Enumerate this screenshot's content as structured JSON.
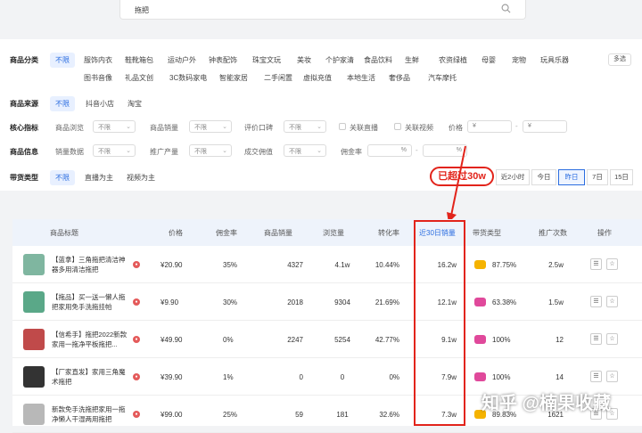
{
  "search": {
    "value": "拖把"
  },
  "filters": {
    "category": {
      "label": "商品分类",
      "options": [
        "不限",
        "服饰内衣",
        "鞋靴箱包",
        "运动户外",
        "钟表配饰",
        "珠宝文玩",
        "美妆",
        "个护家清",
        "食品饮料",
        "生鲜",
        "农资绿植",
        "母婴",
        "宠物",
        "玩具乐器",
        "图书音像",
        "礼品文创",
        "3C数码家电",
        "智能家居",
        "二手闲置",
        "虚拟充值",
        "本地生活",
        "奢侈品",
        "汽车摩托"
      ],
      "more": "多选"
    },
    "source": {
      "label": "商品来源",
      "options": [
        "不限",
        "抖音小店",
        "淘宝"
      ]
    },
    "core": {
      "label": "核心指标",
      "fields": [
        {
          "label": "商品浏览",
          "value": "不限"
        },
        {
          "label": "商品销量",
          "value": "不限"
        },
        {
          "label": "评价口碑",
          "value": "不限"
        }
      ],
      "checkboxes": [
        "关联直播",
        "关联视频"
      ],
      "price_label": "价格",
      "price_from": "¥",
      "price_to": "¥"
    },
    "info": {
      "label": "商品信息",
      "fields": [
        {
          "label": "销量数据",
          "value": "不限"
        },
        {
          "label": "推广产量",
          "value": "不限"
        },
        {
          "label": "成交佣值",
          "value": "不限"
        }
      ],
      "commission_label": "佣金率",
      "commission_from": "%",
      "commission_to": "%"
    },
    "type": {
      "label": "带货类型",
      "options": [
        "不限",
        "直播为主",
        "视频为主"
      ]
    },
    "date_tabs": [
      "近2小时",
      "今日",
      "昨日",
      "7日",
      "15日"
    ],
    "annotation": "已超过30w"
  },
  "table": {
    "headers": [
      "商品标题",
      "价格",
      "佣金率",
      "商品销量",
      "浏览量",
      "转化率",
      "近30日销量",
      "带货类型",
      "推广次数",
      "操作"
    ],
    "rows": [
      {
        "title": "【蓝拿】三角拖把清洁神器多用清洁拖把",
        "price": "¥20.90",
        "commission": "35%",
        "sales": "4327",
        "views": "4.1w",
        "conv": "10.44%",
        "sales30": "16.2w",
        "type": "87.75%",
        "promo": "2.5w",
        "thumb_color": "#7fb6a0",
        "tag_color": "#f5b300"
      },
      {
        "title": "【拖品】买一送一懒人拖把家用免手洗拖挂帕",
        "price": "¥9.90",
        "commission": "30%",
        "sales": "2018",
        "views": "9304",
        "conv": "21.69%",
        "sales30": "12.1w",
        "type": "63.38%",
        "promo": "1.5w",
        "thumb_color": "#5aa888",
        "tag_color": "#e0499b"
      },
      {
        "title": "【信希手】拖把2022新款家用一拖净平板拖把...",
        "price": "¥49.90",
        "commission": "0%",
        "sales": "2247",
        "views": "5254",
        "conv": "42.77%",
        "sales30": "9.1w",
        "type": "100%",
        "promo": "12",
        "thumb_color": "#c04a4a",
        "tag_color": "#e0499b"
      },
      {
        "title": "【厂家直发】家用三角魔术拖把",
        "price": "¥39.90",
        "commission": "1%",
        "sales": "0",
        "views": "0",
        "conv": "0%",
        "sales30": "7.9w",
        "type": "100%",
        "promo": "14",
        "thumb_color": "#333333",
        "tag_color": "#e0499b"
      },
      {
        "title": "新款免手洗拖把家用一拖净懒人干湿两用拖把",
        "price": "¥99.00",
        "commission": "25%",
        "sales": "59",
        "views": "181",
        "conv": "32.6%",
        "sales30": "7.3w",
        "type": "89.83%",
        "promo": "1621",
        "thumb_color": "#b8b8b8",
        "tag_color": "#f5b300"
      }
    ]
  },
  "watermark": "知乎 @楠果收藏"
}
